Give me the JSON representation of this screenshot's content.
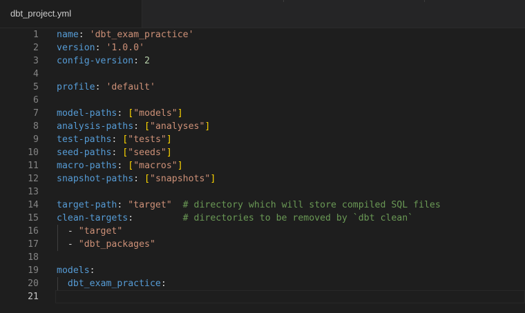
{
  "tab": {
    "filename": "dbt_project.yml"
  },
  "editor": {
    "active_line": 21,
    "lines": [
      {
        "num": "1",
        "tokens": [
          {
            "t": "k",
            "v": "name"
          },
          {
            "t": "p",
            "v": ": "
          },
          {
            "t": "s",
            "v": "'dbt_exam_practice'"
          }
        ]
      },
      {
        "num": "2",
        "tokens": [
          {
            "t": "k",
            "v": "version"
          },
          {
            "t": "p",
            "v": ": "
          },
          {
            "t": "s",
            "v": "'1.0.0'"
          }
        ]
      },
      {
        "num": "3",
        "tokens": [
          {
            "t": "k",
            "v": "config-version"
          },
          {
            "t": "p",
            "v": ": "
          },
          {
            "t": "n",
            "v": "2"
          }
        ]
      },
      {
        "num": "4",
        "tokens": []
      },
      {
        "num": "5",
        "tokens": [
          {
            "t": "k",
            "v": "profile"
          },
          {
            "t": "p",
            "v": ": "
          },
          {
            "t": "s",
            "v": "'default'"
          }
        ]
      },
      {
        "num": "6",
        "tokens": []
      },
      {
        "num": "7",
        "tokens": [
          {
            "t": "k",
            "v": "model-paths"
          },
          {
            "t": "p",
            "v": ": "
          },
          {
            "t": "b",
            "v": "["
          },
          {
            "t": "s",
            "v": "\"models\""
          },
          {
            "t": "b",
            "v": "]"
          }
        ]
      },
      {
        "num": "8",
        "tokens": [
          {
            "t": "k",
            "v": "analysis-paths"
          },
          {
            "t": "p",
            "v": ": "
          },
          {
            "t": "b",
            "v": "["
          },
          {
            "t": "s",
            "v": "\"analyses\""
          },
          {
            "t": "b",
            "v": "]"
          }
        ]
      },
      {
        "num": "9",
        "tokens": [
          {
            "t": "k",
            "v": "test-paths"
          },
          {
            "t": "p",
            "v": ": "
          },
          {
            "t": "b",
            "v": "["
          },
          {
            "t": "s",
            "v": "\"tests\""
          },
          {
            "t": "b",
            "v": "]"
          }
        ]
      },
      {
        "num": "10",
        "tokens": [
          {
            "t": "k",
            "v": "seed-paths"
          },
          {
            "t": "p",
            "v": ": "
          },
          {
            "t": "b",
            "v": "["
          },
          {
            "t": "s",
            "v": "\"seeds\""
          },
          {
            "t": "b",
            "v": "]"
          }
        ]
      },
      {
        "num": "11",
        "tokens": [
          {
            "t": "k",
            "v": "macro-paths"
          },
          {
            "t": "p",
            "v": ": "
          },
          {
            "t": "b",
            "v": "["
          },
          {
            "t": "s",
            "v": "\"macros\""
          },
          {
            "t": "b",
            "v": "]"
          }
        ]
      },
      {
        "num": "12",
        "tokens": [
          {
            "t": "k",
            "v": "snapshot-paths"
          },
          {
            "t": "p",
            "v": ": "
          },
          {
            "t": "b",
            "v": "["
          },
          {
            "t": "s",
            "v": "\"snapshots\""
          },
          {
            "t": "b",
            "v": "]"
          }
        ]
      },
      {
        "num": "13",
        "tokens": []
      },
      {
        "num": "14",
        "tokens": [
          {
            "t": "k",
            "v": "target-path"
          },
          {
            "t": "p",
            "v": ": "
          },
          {
            "t": "s",
            "v": "\"target\""
          },
          {
            "t": "p",
            "v": "  "
          },
          {
            "t": "c",
            "v": "# directory which will store compiled SQL files"
          }
        ]
      },
      {
        "num": "15",
        "tokens": [
          {
            "t": "k",
            "v": "clean-targets"
          },
          {
            "t": "p",
            "v": ":         "
          },
          {
            "t": "c",
            "v": "# directories to be removed by `dbt clean`"
          }
        ]
      },
      {
        "num": "16",
        "tokens": [
          {
            "t": "p",
            "v": "  - "
          },
          {
            "t": "s",
            "v": "\"target\""
          }
        ]
      },
      {
        "num": "17",
        "tokens": [
          {
            "t": "p",
            "v": "  - "
          },
          {
            "t": "s",
            "v": "\"dbt_packages\""
          }
        ]
      },
      {
        "num": "18",
        "tokens": []
      },
      {
        "num": "19",
        "tokens": [
          {
            "t": "k",
            "v": "models"
          },
          {
            "t": "p",
            "v": ":"
          }
        ]
      },
      {
        "num": "20",
        "tokens": [
          {
            "t": "p",
            "v": "  "
          },
          {
            "t": "k",
            "v": "dbt_exam_practice"
          },
          {
            "t": "p",
            "v": ":"
          }
        ]
      },
      {
        "num": "21",
        "tokens": []
      }
    ]
  },
  "colors": {
    "background": "#1e1e1e",
    "key": "#569cd6",
    "string": "#ce9178",
    "number": "#b5cea8",
    "bracket": "#ffd700",
    "comment": "#6a9955",
    "line_number": "#858585"
  }
}
